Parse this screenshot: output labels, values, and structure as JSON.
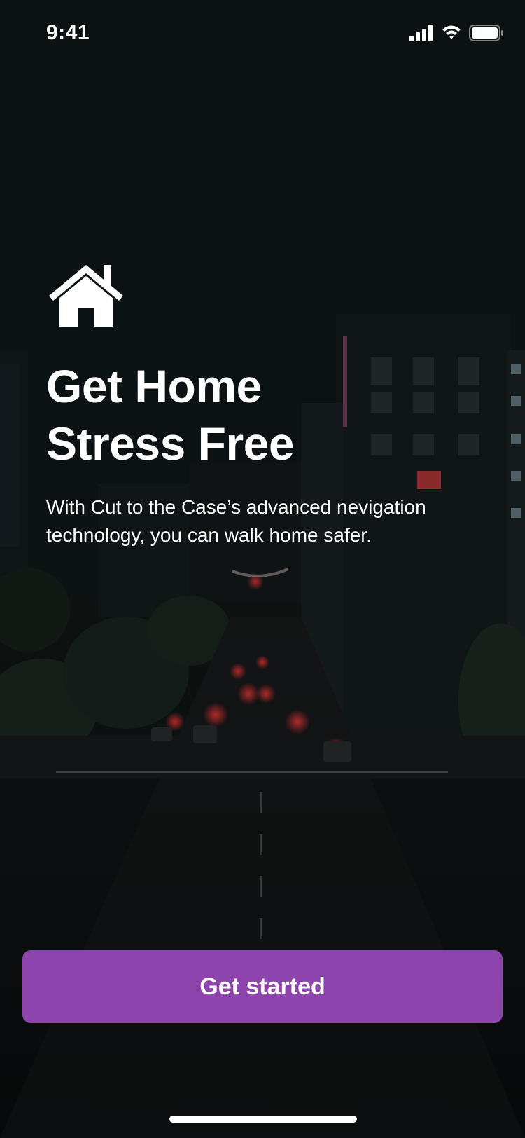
{
  "status_bar": {
    "time": "9:41",
    "icons": [
      "cellular-signal-icon",
      "wifi-icon",
      "battery-icon"
    ]
  },
  "hero": {
    "icon": "home-icon",
    "headline_line1": "Get Home",
    "headline_line2": "Stress Free",
    "description": "With Cut to the Case’s advanced nevigation technology, you can walk home safer."
  },
  "actions": {
    "get_started_label": "Get started"
  },
  "colors": {
    "accent": "#8e44ad",
    "text": "#ffffff",
    "background": "#111a1c"
  }
}
